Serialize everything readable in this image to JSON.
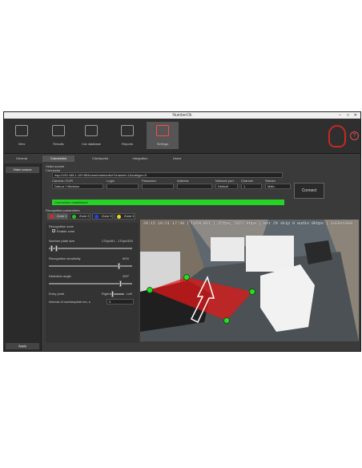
{
  "window": {
    "title": "NumberOk",
    "controls": [
      "–",
      "□",
      "✕"
    ]
  },
  "ribbon": {
    "buttons": [
      {
        "label": "View",
        "icon": "monitor-icon"
      },
      {
        "label": "Results",
        "icon": "car-list-icon"
      },
      {
        "label": "Car database",
        "icon": "car-database-icon"
      },
      {
        "label": "Reports",
        "icon": "report-icon"
      },
      {
        "label": "Settings",
        "icon": "settings-icon"
      }
    ],
    "help": "?"
  },
  "tabs": [
    "General",
    "Connection",
    "Checkpoint",
    "Integration",
    "Users"
  ],
  "sidebar": {
    "item": "Video source",
    "apply": "Apply"
  },
  "connection": {
    "section_label": "Video source",
    "connector_label": "Connector",
    "url": "rtsp://192.168.1.100:554/cam/realmonitor?channel=1&subtype=0",
    "headers": {
      "camera": "Camera / DVR",
      "login": "Login",
      "password": "Password",
      "address": "Address",
      "network_port": "Network port",
      "channel": "Channel",
      "stream": "Stream"
    },
    "values": {
      "camera": "Dahua / Hikvision",
      "network_port": "Default",
      "channel": "1",
      "stream": "Main"
    },
    "connect_button": "Connect",
    "status": "Connection established"
  },
  "recognition": {
    "section_label": "Recognition parameters",
    "zones": [
      {
        "label": "Zone 1",
        "color": "#e52222"
      },
      {
        "label": "Zone 2",
        "color": "#22c422"
      },
      {
        "label": "Zone 3",
        "color": "#2244e5"
      },
      {
        "label": "Zone 4",
        "color": "#e5d422"
      }
    ],
    "zone_title": "Recognition zone",
    "enable_zone": "Enable zone",
    "plate_size_label": "Number plate size",
    "plate_size_value": "170px/61 - 170px/325",
    "sensitivity_label": "Recognition sensitivity",
    "sensitivity_value": "60%",
    "angle_label": "Detection angle",
    "angle_value": "200°",
    "entry_label": "Entry point",
    "entry_left": "Right",
    "entry_right": "Left",
    "interval_label": "Interval of numberplate rec, s",
    "interval_value": "3"
  },
  "video": {
    "osd": "20:15 10:21 17:30 | h264 ROI | 25fps, 5657 kbps | ext 2% skip 0 audio 0kbps | 1920x1080",
    "colors": {
      "zone": "#e01818",
      "handle": "#22dd22"
    }
  }
}
